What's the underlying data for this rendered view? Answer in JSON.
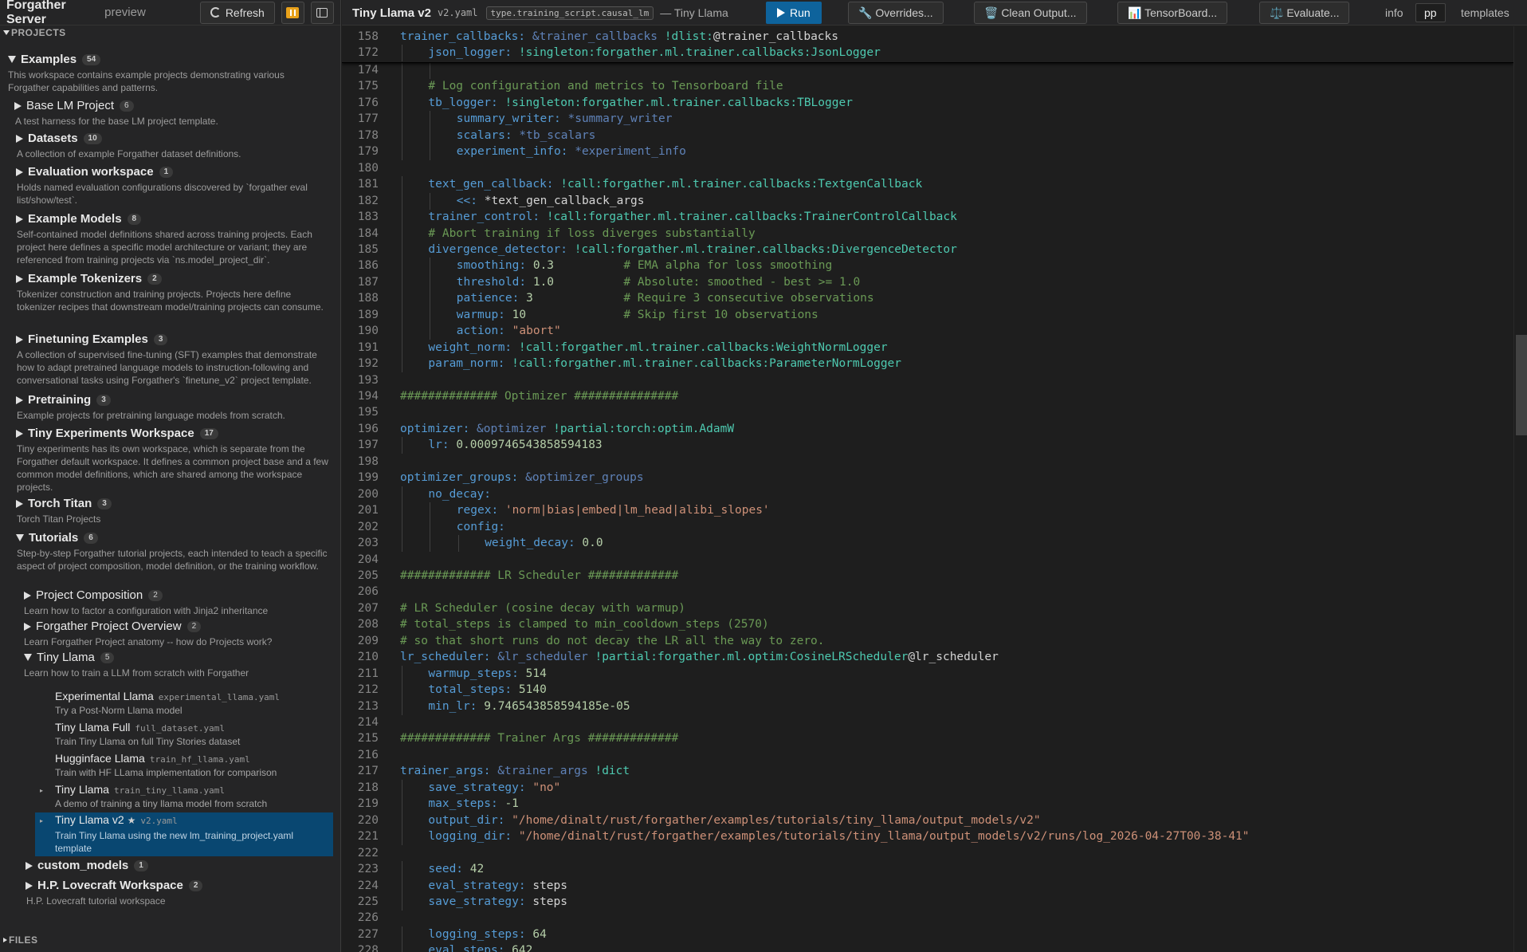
{
  "app": {
    "title": "Forgather Server",
    "subtitle": "preview",
    "refresh_label": "Refresh"
  },
  "sections": {
    "projects": "PROJECTS",
    "files": "FILES"
  },
  "tree": {
    "examples": {
      "label": "Examples",
      "count": "54",
      "desc": "This workspace contains example projects demonstrating various Forgather capabilities and patterns."
    },
    "base_lm": {
      "label": "Base LM Project",
      "count": "6",
      "desc": "A test harness for the base LM project template."
    },
    "datasets": {
      "label": "Datasets",
      "count": "10",
      "desc": "A collection of example Forgather dataset definitions."
    },
    "eval_ws": {
      "label": "Evaluation workspace",
      "count": "1",
      "desc": "Holds named evaluation configurations discovered by `forgather eval list/show/test`."
    },
    "example_models": {
      "label": "Example Models",
      "count": "8",
      "desc": "Self-contained model definitions shared across training projects. Each project here defines a specific model architecture or variant; they are referenced from training projects via `ns.model_project_dir`."
    },
    "example_tokenizers": {
      "label": "Example Tokenizers",
      "count": "2",
      "desc": "Tokenizer construction and training projects. Projects here define tokenizer recipes that downstream model/training projects can consume."
    },
    "finetuning": {
      "label": "Finetuning Examples",
      "count": "3",
      "desc": "A collection of supervised fine-tuning (SFT) examples that demonstrate how to adapt pretrained language models to instruction-following and conversational tasks using Forgather's `finetune_v2` project template."
    },
    "pretraining": {
      "label": "Pretraining",
      "count": "3",
      "desc": "Example projects for pretraining language models from scratch."
    },
    "tiny_exp": {
      "label": "Tiny Experiments Workspace",
      "count": "17",
      "desc": "Tiny experiments has its own workspace, which is separate from the Forgather default workspace. It defines a common project base and a few common model definitions, which are shared among the workspace projects."
    },
    "torch_titan": {
      "label": "Torch Titan",
      "count": "3",
      "desc": "Torch Titan Projects"
    },
    "tutorials": {
      "label": "Tutorials",
      "count": "6",
      "desc": "Step-by-step Forgather tutorial projects, each intended to teach a specific aspect of project composition, model definition, or the training workflow."
    },
    "proj_comp": {
      "label": "Project Composition",
      "count": "2",
      "desc": "Learn how to factor a configuration with Jinja2 inheritance"
    },
    "proj_overview": {
      "label": "Forgather Project Overview",
      "count": "2",
      "desc": "Learn Forgather Project anatomy -- how do Projects work?"
    },
    "tiny_llama": {
      "label": "Tiny Llama",
      "count": "5",
      "desc": "Learn how to train a LLM from scratch with Forgather"
    },
    "leaves": [
      {
        "title": "Experimental Llama",
        "file": "experimental_llama.yaml",
        "desc": "Try a Post-Norm Llama model"
      },
      {
        "title": "Tiny Llama Full",
        "file": "full_dataset.yaml",
        "desc": "Train Tiny Llama on full Tiny Stories dataset"
      },
      {
        "title": "Hugginface Llama",
        "file": "train_hf_llama.yaml",
        "desc": "Train with HF LLama implementation for comparison"
      },
      {
        "title": "Tiny Llama",
        "file": "train_tiny_llama.yaml",
        "desc": "A demo of training a tiny llama model from scratch"
      },
      {
        "title": "Tiny Llama v2",
        "file": "v2.yaml",
        "desc": "Train Tiny Llama using the new lm_training_project.yaml template"
      }
    ],
    "custom_models": {
      "label": "custom_models",
      "count": "1"
    },
    "lovecraft": {
      "label": "H.P. Lovecraft Workspace",
      "count": "2",
      "desc": "H.P. Lovecraft tutorial workspace"
    }
  },
  "topbar": {
    "title": "Tiny Llama v2",
    "file": "v2.yaml",
    "type": "type.training_script.causal_lm",
    "crumb": "— Tiny Llama",
    "run": "Run",
    "overrides": "🔧 Overrides...",
    "clean": "🗑️ Clean Output...",
    "tensorboard": "📊 TensorBoard...",
    "evaluate": "⚖️ Evaluate...",
    "tab_info": "info",
    "tab_pp": "pp",
    "tab_templates": "templates"
  },
  "code": {
    "sticky": [
      {
        "n": "158",
        "i": 0,
        "tokens": [
          [
            "k",
            "trainer_callbacks:"
          ],
          [
            "p",
            " "
          ],
          [
            "a",
            "&trainer_callbacks"
          ],
          [
            "p",
            " "
          ],
          [
            "t",
            "!dlist:"
          ],
          [
            "p",
            "@trainer_callbacks"
          ]
        ]
      },
      {
        "n": "172",
        "i": 1,
        "tokens": [
          [
            "k",
            "json_logger:"
          ],
          [
            "p",
            " "
          ],
          [
            "t",
            "!singleton:forgather.ml.trainer.callbacks:JsonLogger"
          ]
        ]
      }
    ],
    "lines": [
      {
        "n": "174",
        "i": 2,
        "tokens": []
      },
      {
        "n": "175",
        "i": 1,
        "tokens": [
          [
            "c",
            "# Log configuration and metrics to Tensorboard file"
          ]
        ]
      },
      {
        "n": "176",
        "i": 1,
        "tokens": [
          [
            "k",
            "tb_logger:"
          ],
          [
            "p",
            " "
          ],
          [
            "t",
            "!singleton:forgather.ml.trainer.callbacks:TBLogger"
          ]
        ]
      },
      {
        "n": "177",
        "i": 2,
        "tokens": [
          [
            "k",
            "summary_writer:"
          ],
          [
            "p",
            " "
          ],
          [
            "a",
            "*summary_writer"
          ]
        ]
      },
      {
        "n": "178",
        "i": 2,
        "tokens": [
          [
            "k",
            "scalars:"
          ],
          [
            "p",
            " "
          ],
          [
            "a",
            "*tb_scalars"
          ]
        ]
      },
      {
        "n": "179",
        "i": 2,
        "tokens": [
          [
            "k",
            "experiment_info:"
          ],
          [
            "p",
            " "
          ],
          [
            "a",
            "*experiment_info"
          ]
        ]
      },
      {
        "n": "180",
        "i": 0,
        "tokens": []
      },
      {
        "n": "181",
        "i": 1,
        "tokens": [
          [
            "k",
            "text_gen_callback:"
          ],
          [
            "p",
            " "
          ],
          [
            "t",
            "!call:forgather.ml.trainer.callbacks:TextgenCallback"
          ]
        ]
      },
      {
        "n": "182",
        "i": 2,
        "tokens": [
          [
            "k",
            "<<:"
          ],
          [
            "p",
            " *text_gen_callback_args"
          ]
        ]
      },
      {
        "n": "183",
        "i": 1,
        "tokens": [
          [
            "k",
            "trainer_control:"
          ],
          [
            "p",
            " "
          ],
          [
            "t",
            "!call:forgather.ml.trainer.callbacks:TrainerControlCallback"
          ]
        ]
      },
      {
        "n": "184",
        "i": 1,
        "tokens": [
          [
            "c",
            "# Abort training if loss diverges substantially"
          ]
        ]
      },
      {
        "n": "185",
        "i": 1,
        "tokens": [
          [
            "k",
            "divergence_detector:"
          ],
          [
            "p",
            " "
          ],
          [
            "t",
            "!call:forgather.ml.trainer.callbacks:DivergenceDetector"
          ]
        ]
      },
      {
        "n": "186",
        "i": 2,
        "tokens": [
          [
            "k",
            "smoothing:"
          ],
          [
            "p",
            " "
          ],
          [
            "n",
            "0.3"
          ],
          [
            "p",
            "          "
          ],
          [
            "c",
            "# EMA alpha for loss smoothing"
          ]
        ]
      },
      {
        "n": "187",
        "i": 2,
        "tokens": [
          [
            "k",
            "threshold:"
          ],
          [
            "p",
            " "
          ],
          [
            "n",
            "1.0"
          ],
          [
            "p",
            "          "
          ],
          [
            "c",
            "# Absolute: smoothed - best >= 1.0"
          ]
        ]
      },
      {
        "n": "188",
        "i": 2,
        "tokens": [
          [
            "k",
            "patience:"
          ],
          [
            "p",
            " "
          ],
          [
            "n",
            "3"
          ],
          [
            "p",
            "             "
          ],
          [
            "c",
            "# Require 3 consecutive observations"
          ]
        ]
      },
      {
        "n": "189",
        "i": 2,
        "tokens": [
          [
            "k",
            "warmup:"
          ],
          [
            "p",
            " "
          ],
          [
            "n",
            "10"
          ],
          [
            "p",
            "              "
          ],
          [
            "c",
            "# Skip first 10 observations"
          ]
        ]
      },
      {
        "n": "190",
        "i": 2,
        "tokens": [
          [
            "k",
            "action:"
          ],
          [
            "p",
            " "
          ],
          [
            "s",
            "\"abort\""
          ]
        ]
      },
      {
        "n": "191",
        "i": 1,
        "tokens": [
          [
            "k",
            "weight_norm:"
          ],
          [
            "p",
            " "
          ],
          [
            "t",
            "!call:forgather.ml.trainer.callbacks:WeightNormLogger"
          ]
        ]
      },
      {
        "n": "192",
        "i": 1,
        "tokens": [
          [
            "k",
            "param_norm:"
          ],
          [
            "p",
            " "
          ],
          [
            "t",
            "!call:forgather.ml.trainer.callbacks:ParameterNormLogger"
          ]
        ]
      },
      {
        "n": "193",
        "i": 0,
        "tokens": []
      },
      {
        "n": "194",
        "i": 0,
        "tokens": [
          [
            "c",
            "############## Optimizer ###############"
          ]
        ]
      },
      {
        "n": "195",
        "i": 0,
        "tokens": []
      },
      {
        "n": "196",
        "i": 0,
        "tokens": [
          [
            "k",
            "optimizer:"
          ],
          [
            "p",
            " "
          ],
          [
            "a",
            "&optimizer"
          ],
          [
            "p",
            " "
          ],
          [
            "t",
            "!partial:torch:optim.AdamW"
          ]
        ]
      },
      {
        "n": "197",
        "i": 1,
        "tokens": [
          [
            "k",
            "lr:"
          ],
          [
            "p",
            " "
          ],
          [
            "n",
            "0.0009746543858594183"
          ]
        ]
      },
      {
        "n": "198",
        "i": 0,
        "tokens": []
      },
      {
        "n": "199",
        "i": 0,
        "tokens": [
          [
            "k",
            "optimizer_groups:"
          ],
          [
            "p",
            " "
          ],
          [
            "a",
            "&optimizer_groups"
          ]
        ]
      },
      {
        "n": "200",
        "i": 1,
        "tokens": [
          [
            "k",
            "no_decay:"
          ]
        ]
      },
      {
        "n": "201",
        "i": 2,
        "tokens": [
          [
            "k",
            "regex:"
          ],
          [
            "p",
            " "
          ],
          [
            "s",
            "'norm|bias|embed|lm_head|alibi_slopes'"
          ]
        ]
      },
      {
        "n": "202",
        "i": 2,
        "tokens": [
          [
            "k",
            "config:"
          ]
        ]
      },
      {
        "n": "203",
        "i": 3,
        "tokens": [
          [
            "k",
            "weight_decay:"
          ],
          [
            "p",
            " "
          ],
          [
            "n",
            "0.0"
          ]
        ]
      },
      {
        "n": "204",
        "i": 0,
        "tokens": []
      },
      {
        "n": "205",
        "i": 0,
        "tokens": [
          [
            "c",
            "############# LR Scheduler #############"
          ]
        ]
      },
      {
        "n": "206",
        "i": 0,
        "tokens": []
      },
      {
        "n": "207",
        "i": 0,
        "tokens": [
          [
            "c",
            "# LR Scheduler (cosine decay with warmup)"
          ]
        ]
      },
      {
        "n": "208",
        "i": 0,
        "tokens": [
          [
            "c",
            "# total_steps is clamped to min_cooldown_steps (2570)"
          ]
        ]
      },
      {
        "n": "209",
        "i": 0,
        "tokens": [
          [
            "c",
            "# so that short runs do not decay the LR all the way to zero."
          ]
        ]
      },
      {
        "n": "210",
        "i": 0,
        "tokens": [
          [
            "k",
            "lr_scheduler:"
          ],
          [
            "p",
            " "
          ],
          [
            "a",
            "&lr_scheduler"
          ],
          [
            "p",
            " "
          ],
          [
            "t",
            "!partial:forgather.ml.optim:CosineLRScheduler"
          ],
          [
            "p",
            "@lr_scheduler"
          ]
        ]
      },
      {
        "n": "211",
        "i": 1,
        "tokens": [
          [
            "k",
            "warmup_steps:"
          ],
          [
            "p",
            " "
          ],
          [
            "n",
            "514"
          ]
        ]
      },
      {
        "n": "212",
        "i": 1,
        "tokens": [
          [
            "k",
            "total_steps:"
          ],
          [
            "p",
            " "
          ],
          [
            "n",
            "5140"
          ]
        ]
      },
      {
        "n": "213",
        "i": 1,
        "tokens": [
          [
            "k",
            "min_lr:"
          ],
          [
            "p",
            " "
          ],
          [
            "n",
            "9.746543858594185e-05"
          ]
        ]
      },
      {
        "n": "214",
        "i": 0,
        "tokens": []
      },
      {
        "n": "215",
        "i": 0,
        "tokens": [
          [
            "c",
            "############# Trainer Args #############"
          ]
        ]
      },
      {
        "n": "216",
        "i": 0,
        "tokens": []
      },
      {
        "n": "217",
        "i": 0,
        "tokens": [
          [
            "k",
            "trainer_args:"
          ],
          [
            "p",
            " "
          ],
          [
            "a",
            "&trainer_args"
          ],
          [
            "p",
            " "
          ],
          [
            "t",
            "!dict"
          ]
        ]
      },
      {
        "n": "218",
        "i": 1,
        "tokens": [
          [
            "k",
            "save_strategy:"
          ],
          [
            "p",
            " "
          ],
          [
            "s",
            "\"no\""
          ]
        ]
      },
      {
        "n": "219",
        "i": 1,
        "tokens": [
          [
            "k",
            "max_steps:"
          ],
          [
            "p",
            " "
          ],
          [
            "n",
            "-1"
          ]
        ]
      },
      {
        "n": "220",
        "i": 1,
        "tokens": [
          [
            "k",
            "output_dir:"
          ],
          [
            "p",
            " "
          ],
          [
            "s",
            "\"/home/dinalt/rust/forgather/examples/tutorials/tiny_llama/output_models/v2\""
          ]
        ]
      },
      {
        "n": "221",
        "i": 1,
        "tokens": [
          [
            "k",
            "logging_dir:"
          ],
          [
            "p",
            " "
          ],
          [
            "s",
            "\"/home/dinalt/rust/forgather/examples/tutorials/tiny_llama/output_models/v2/runs/log_2026-04-27T00-38-41\""
          ]
        ]
      },
      {
        "n": "222",
        "i": 0,
        "tokens": []
      },
      {
        "n": "223",
        "i": 1,
        "tokens": [
          [
            "k",
            "seed:"
          ],
          [
            "p",
            " "
          ],
          [
            "n",
            "42"
          ]
        ]
      },
      {
        "n": "224",
        "i": 1,
        "tokens": [
          [
            "k",
            "eval_strategy:"
          ],
          [
            "p",
            " steps"
          ]
        ]
      },
      {
        "n": "225",
        "i": 1,
        "tokens": [
          [
            "k",
            "save_strategy:"
          ],
          [
            "p",
            " steps"
          ]
        ]
      },
      {
        "n": "226",
        "i": 0,
        "tokens": []
      },
      {
        "n": "227",
        "i": 1,
        "tokens": [
          [
            "k",
            "logging_steps:"
          ],
          [
            "p",
            " "
          ],
          [
            "n",
            "64"
          ]
        ]
      },
      {
        "n": "228",
        "i": 1,
        "tokens": [
          [
            "k",
            "eval_steps:"
          ],
          [
            "p",
            " "
          ],
          [
            "n",
            "642"
          ]
        ]
      }
    ]
  }
}
